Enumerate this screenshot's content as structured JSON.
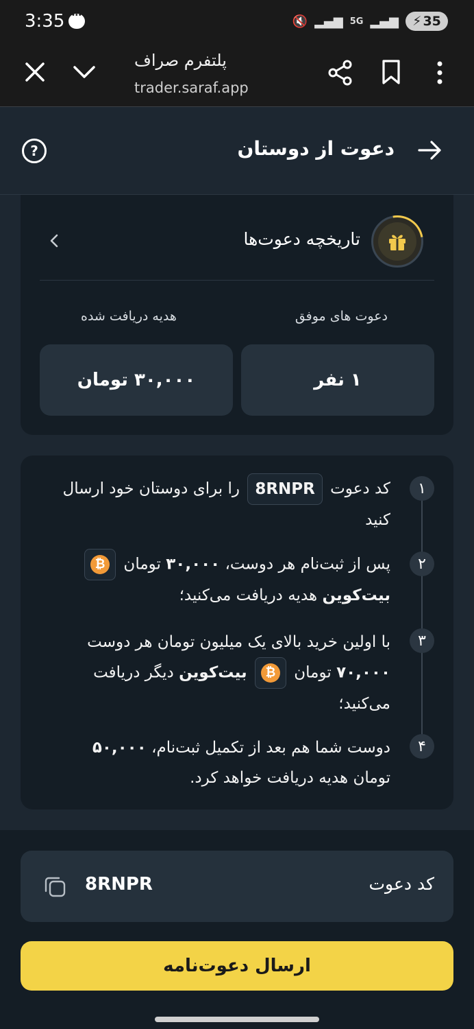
{
  "status_bar": {
    "time": "3:35",
    "network": "5G",
    "battery": "35"
  },
  "browser": {
    "title": "پلتفرم صراف",
    "url": "trader.saraf.app"
  },
  "header": {
    "title": "دعوت از دوستان"
  },
  "history": {
    "title": "تاریخچه دعوت‌ها",
    "successful_label": "دعوت های موفق",
    "successful_value": "۱ نفر",
    "gift_label": "هدیه دریافت شده",
    "gift_value": "۳۰,۰۰۰ تومان"
  },
  "steps": [
    {
      "number": "۱",
      "before": "کد دعوت",
      "code": "8RNPR",
      "after": "را برای دوستان خود ارسال کنید"
    },
    {
      "number": "۲",
      "part1": "پس از ثبت‌نام هر دوست،",
      "amount": "۳۰,۰۰۰",
      "part2": "تومان",
      "coin": "بیت‌کوین",
      "part3": "هدیه دریافت می‌کنید؛"
    },
    {
      "number": "۳",
      "part1": "با اولین خرید بالای یک میلیون تومان هر دوست",
      "amount": "۷۰,۰۰۰",
      "part2": "تومان",
      "coin": "بیت‌کوین",
      "part3": "دیگر دریافت می‌کنید؛"
    },
    {
      "number": "۴",
      "part1": "دوست شما هم بعد از تکمیل ثبت‌نام،",
      "amount": "۵۰,۰۰۰",
      "part2": "تومان هدیه دریافت خواهد کرد."
    }
  ],
  "invite": {
    "label": "کد دعوت",
    "code": "8RNPR",
    "send_button": "ارسال دعوت‌نامه"
  },
  "colors": {
    "background": "#1d2731",
    "card": "#141d25",
    "accent": "#f3d347",
    "bitcoin": "#f29a38"
  }
}
